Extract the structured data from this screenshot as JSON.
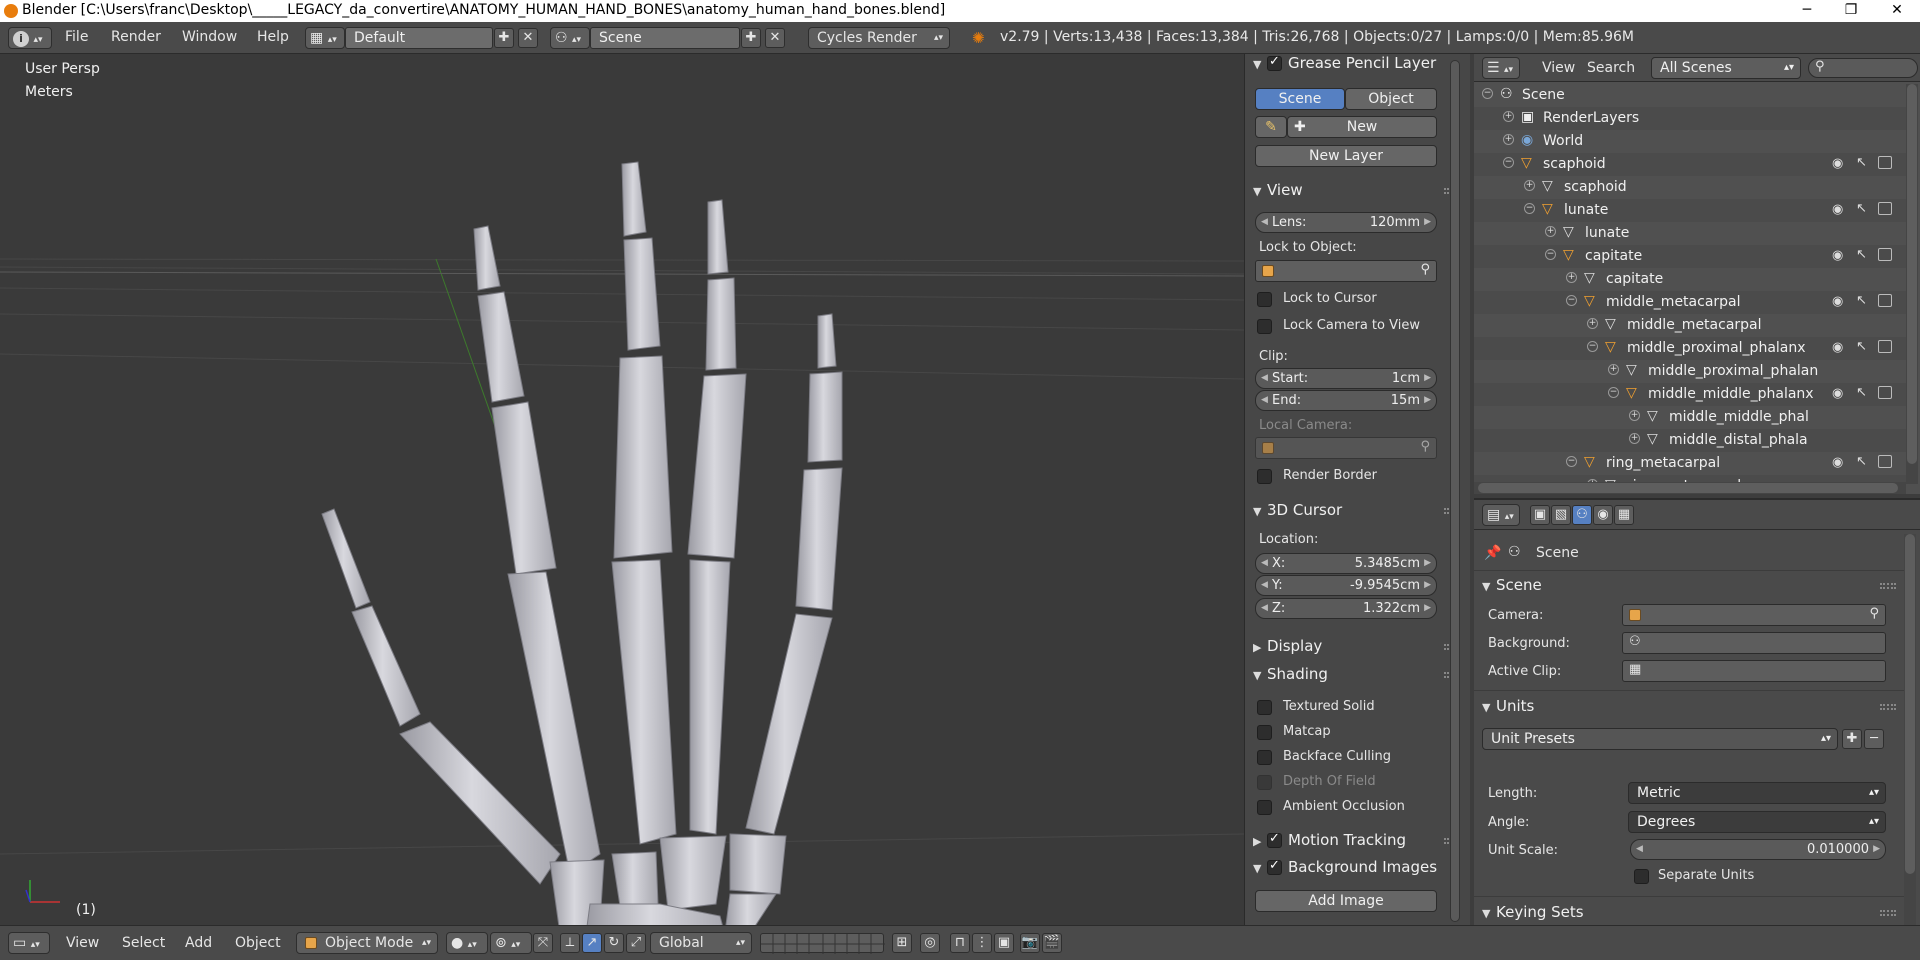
{
  "window": {
    "title": "Blender [C:\\Users\\franc\\Desktop\\_____LEGACY_da_convertire\\ANATOMY_HUMAN_HAND_BONES\\anatomy_human_hand_bones.blend]",
    "min": "─",
    "max": "❐",
    "close": "✕"
  },
  "topbar": {
    "menus": [
      "File",
      "Render",
      "Window",
      "Help"
    ],
    "layout": "Default",
    "scene": "Scene",
    "engine": "Cycles Render",
    "stats": "v2.79 | Verts:13,438 | Faces:13,384 | Tris:26,768 | Objects:0/27 | Lamps:0/0 | Mem:85.96M"
  },
  "viewport": {
    "view_name": "User Persp",
    "units": "Meters",
    "frame": "(1)"
  },
  "npanel": {
    "grease_pencil": {
      "header": "Grease Pencil Layer",
      "tab_scene": "Scene",
      "tab_object": "Object",
      "new": "New",
      "new_layer": "New Layer"
    },
    "view": {
      "header": "View",
      "lens_label": "Lens:",
      "lens_value": "120mm",
      "lock_to_object": "Lock to Object:",
      "lock_to_cursor": "Lock to Cursor",
      "lock_camera": "Lock Camera to View",
      "clip": "Clip:",
      "start_label": "Start:",
      "start_value": "1cm",
      "end_label": "End:",
      "end_value": "15m",
      "local_camera": "Local Camera:",
      "render_border": "Render Border"
    },
    "cursor": {
      "header": "3D Cursor",
      "location": "Location:",
      "x_label": "X:",
      "x_value": "5.3485cm",
      "y_label": "Y:",
      "y_value": "-9.9545cm",
      "z_label": "Z:",
      "z_value": "1.322cm"
    },
    "display_header": "Display",
    "shading": {
      "header": "Shading",
      "textured_solid": "Textured Solid",
      "matcap": "Matcap",
      "backface_culling": "Backface Culling",
      "depth_of_field": "Depth Of Field",
      "ambient_occlusion": "Ambient Occlusion"
    },
    "motion_tracking": "Motion Tracking",
    "background_images": "Background Images",
    "add_image": "Add Image"
  },
  "outliner": {
    "view": "View",
    "search": "Search",
    "filter": "All Scenes",
    "rows": [
      {
        "name": "Scene",
        "indent": 0
      },
      {
        "name": "RenderLayers",
        "indent": 1
      },
      {
        "name": "World",
        "indent": 1
      },
      {
        "name": "scaphoid",
        "indent": 1
      },
      {
        "name": "scaphoid",
        "indent": 2
      },
      {
        "name": "lunate",
        "indent": 2
      },
      {
        "name": "lunate",
        "indent": 3
      },
      {
        "name": "capitate",
        "indent": 3
      },
      {
        "name": "capitate",
        "indent": 4
      },
      {
        "name": "middle_metacarpal",
        "indent": 4
      },
      {
        "name": "middle_metacarpal",
        "indent": 5
      },
      {
        "name": "middle_proximal_phalanx",
        "indent": 5
      },
      {
        "name": "middle_proximal_phalan",
        "indent": 6
      },
      {
        "name": "middle_middle_phalanx",
        "indent": 6
      },
      {
        "name": "middle_middle_phal",
        "indent": 7
      },
      {
        "name": "middle_distal_phala",
        "indent": 7
      },
      {
        "name": "ring_metacarpal",
        "indent": 4
      },
      {
        "name": "ring_metacarpal",
        "indent": 5
      }
    ]
  },
  "properties": {
    "context": "Scene",
    "scene_header": "Scene",
    "camera_label": "Camera:",
    "background_label": "Background:",
    "active_clip_label": "Active Clip:",
    "units_header": "Units",
    "unit_presets": "Unit Presets",
    "length_label": "Length:",
    "length_value": "Metric",
    "angle_label": "Angle:",
    "angle_value": "Degrees",
    "unit_scale_label": "Unit Scale:",
    "unit_scale_value": "0.010000",
    "separate_units": "Separate Units",
    "keying_sets_header": "Keying Sets"
  },
  "bottombar": {
    "menus": [
      "View",
      "Select",
      "Add",
      "Object"
    ],
    "mode": "Object Mode",
    "orientation": "Global"
  }
}
